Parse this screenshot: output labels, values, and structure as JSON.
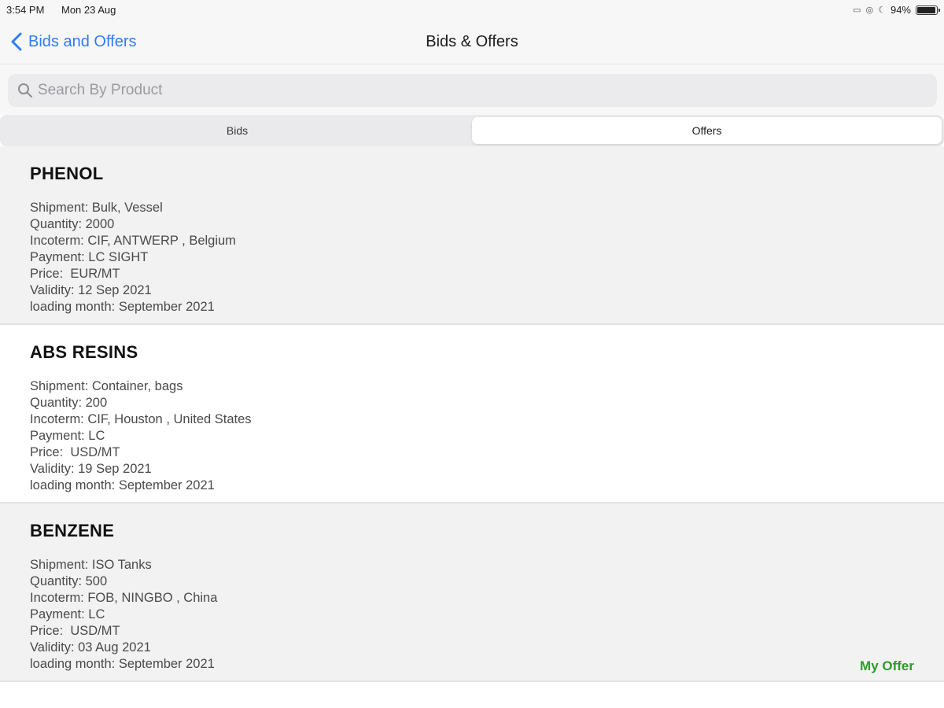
{
  "status_bar": {
    "time": "3:54 PM",
    "date": "Mon 23 Aug",
    "battery_text": "94%",
    "battery_level": 0.94
  },
  "nav": {
    "back_label": "Bids and Offers",
    "title": "Bids & Offers"
  },
  "search": {
    "placeholder": "Search By Product",
    "value": ""
  },
  "segments": {
    "bids": "Bids",
    "offers": "Offers",
    "selected": "Offers"
  },
  "items": [
    {
      "title": "PHENOL",
      "shipment": "Shipment: Bulk, Vessel",
      "quantity": "Quantity: 2000",
      "incoterm": "Incoterm: CIF, ANTWERP , Belgium",
      "payment": "Payment: LC SIGHT",
      "price": "Price:  EUR/MT",
      "validity": "Validity: 12 Sep 2021",
      "loading": "loading month: September 2021",
      "tag": ""
    },
    {
      "title": "ABS RESINS",
      "shipment": "Shipment: Container, bags",
      "quantity": "Quantity: 200",
      "incoterm": "Incoterm: CIF, Houston , United States",
      "payment": "Payment: LC",
      "price": "Price:  USD/MT",
      "validity": "Validity: 19 Sep 2021",
      "loading": "loading month: September 2021",
      "tag": ""
    },
    {
      "title": "BENZENE",
      "shipment": "Shipment: ISO Tanks",
      "quantity": "Quantity: 500",
      "incoterm": "Incoterm: FOB, NINGBO , China",
      "payment": "Payment: LC",
      "price": "Price:  USD/MT",
      "validity": "Validity: 03 Aug 2021",
      "loading": "loading month: September 2021",
      "tag": "My Offer"
    }
  ],
  "colors": {
    "accent": "#2f7cf6",
    "my_offer": "#2e9b2e"
  },
  "icons": [
    "back-chevron-icon",
    "search-icon",
    "battery-icon"
  ]
}
